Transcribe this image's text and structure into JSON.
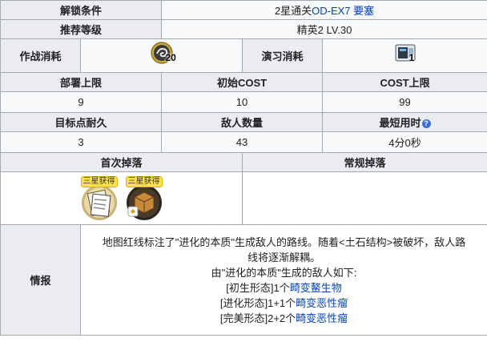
{
  "unlock": {
    "label": "解锁条件",
    "value_prefix": "2星通关",
    "value_link": "OD-EX7 要塞"
  },
  "recommend": {
    "label": "推荐等级",
    "value": "精英2 LV.30"
  },
  "sanity": {
    "label": "作战消耗",
    "amount": "20",
    "icon": "sanity-icon"
  },
  "practice": {
    "label": "演习消耗",
    "amount": "1",
    "icon": "practice-ticket-icon"
  },
  "stats_row1": {
    "headers": [
      "部署上限",
      "初始COST",
      "COST上限"
    ],
    "values": [
      "9",
      "10",
      "99"
    ]
  },
  "stats_row2": {
    "headers": [
      "目标点耐久",
      "敌人数量",
      "最短用时"
    ],
    "values": [
      "3",
      "43",
      "4分0秒"
    ]
  },
  "drops": {
    "first_label": "首次掉落",
    "regular_label": "常规掉落",
    "items": [
      {
        "badge": "三星获得",
        "icon": "document-material-icon"
      },
      {
        "badge": "三星获得",
        "icon": "crate-material-icon"
      }
    ]
  },
  "intel": {
    "label": "情报",
    "line1": "地图红线标注了\"进化的本质\"生成敌人的路线。随着<土石结构>被破坏，敌人路",
    "line2": "线将逐渐解耦。",
    "line3": "由\"进化的本质\"生成的敌人如下:",
    "forms": [
      {
        "prefix": "[初生形态]1个",
        "link": "畸变鳌生物"
      },
      {
        "prefix": "[进化形态]1+1个",
        "link": "畸变恶性瘤"
      },
      {
        "prefix": "[完美形态]2+2个",
        "link": "畸变恶性瘤"
      }
    ]
  },
  "colors": {
    "header_bg": "#eaecf0",
    "cell_bg": "#f8f9fa",
    "border": "#a2a9b1",
    "link": "#0645ad"
  }
}
